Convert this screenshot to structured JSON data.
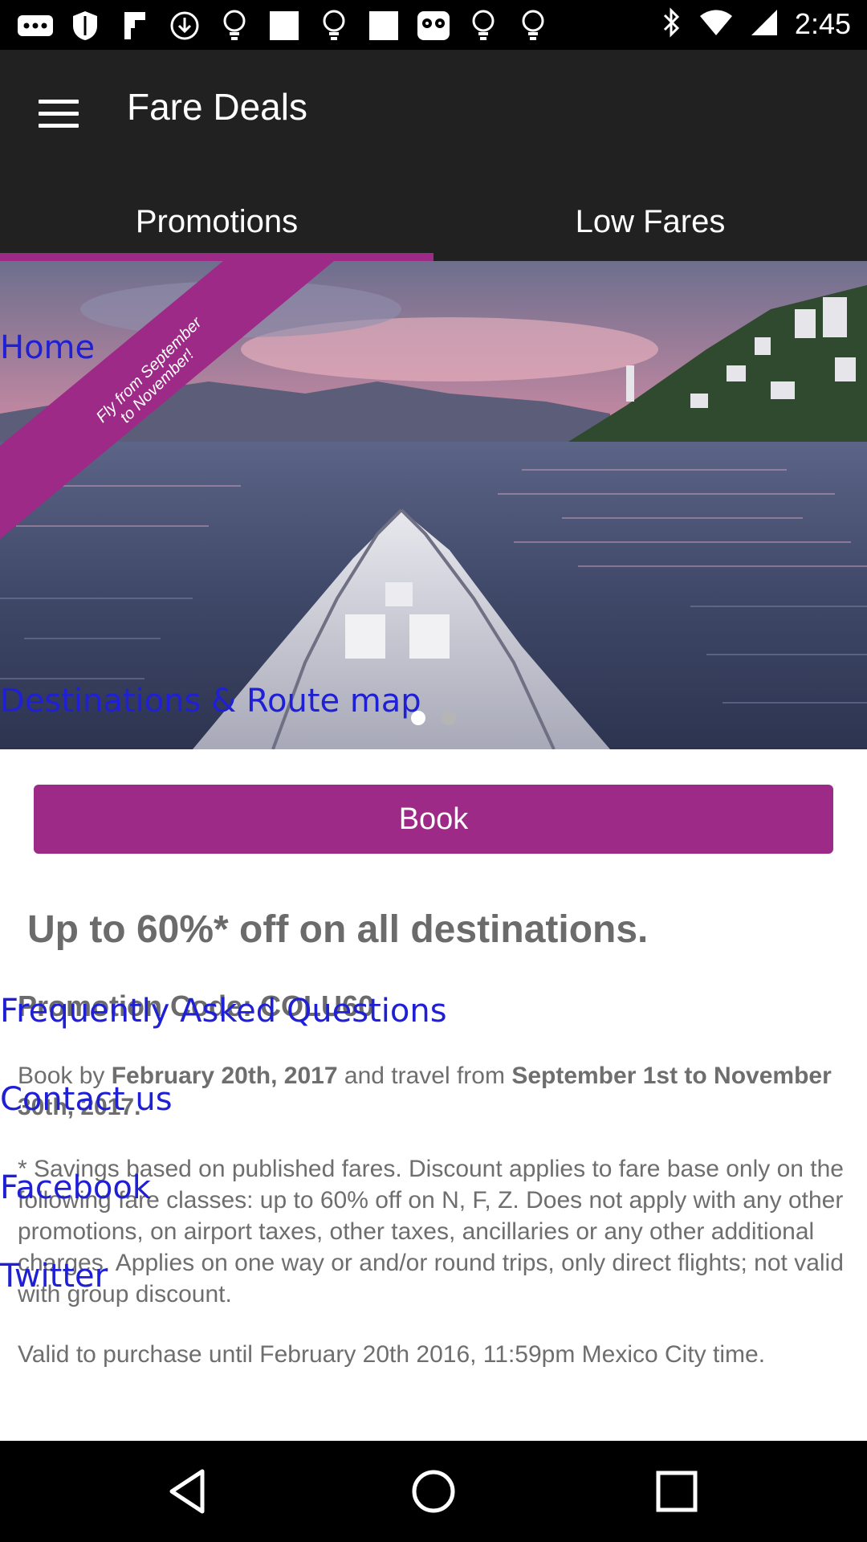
{
  "status_bar": {
    "time": "2:45",
    "left_icons": [
      "more-icon",
      "shield-icon",
      "flipboard-icon",
      "download-icon",
      "lightbulb-icon",
      "square-icon",
      "lightbulb-icon",
      "square-icon",
      "owl-icon",
      "lightbulb-icon",
      "lightbulb-icon"
    ],
    "right_icons": [
      "bluetooth-icon",
      "wifi-icon",
      "signal-icon"
    ]
  },
  "app_bar": {
    "title": "Fare Deals",
    "tabs": [
      {
        "label": "Promotions",
        "selected": true
      },
      {
        "label": "Low Fares",
        "selected": false
      }
    ],
    "accent_color": "#9d2a87"
  },
  "hero": {
    "ribbon_text": "Fly from September to November!",
    "slide_count": 2,
    "active_slide": 1
  },
  "book_button": {
    "label": "Book"
  },
  "content": {
    "headline": "Up to 60%* off on all destinations.",
    "promo_code": "Promotion Code: COLU60",
    "p1_prefix": "Book by ",
    "p1_date1": "February 20th, 2017",
    "p1_mid": " and travel from ",
    "p1_date2": "September 1st to November 30th, 2017.",
    "p2": "* Savings based on published fares. Discount applies to fare base only on the following fare classes: up to 60% off on N, F, Z. Does not apply with any other promotions, on airport taxes, other taxes, ancillaries or any other additional charges. Applies on one way or and/or round trips, only direct flights; not valid with group discount.",
    "p3": "Valid to purchase until February 20th 2016, 11:59pm Mexico City time."
  },
  "overlay_links": {
    "home": "Home",
    "destinations": "Destinations & Route map",
    "faq": "Frequently Asked Questions",
    "contact": "Contact us",
    "facebook": "Facebook",
    "twitter": "Twitter"
  },
  "nav_bar": {
    "buttons": [
      "back-icon",
      "home-icon",
      "recents-icon"
    ]
  }
}
